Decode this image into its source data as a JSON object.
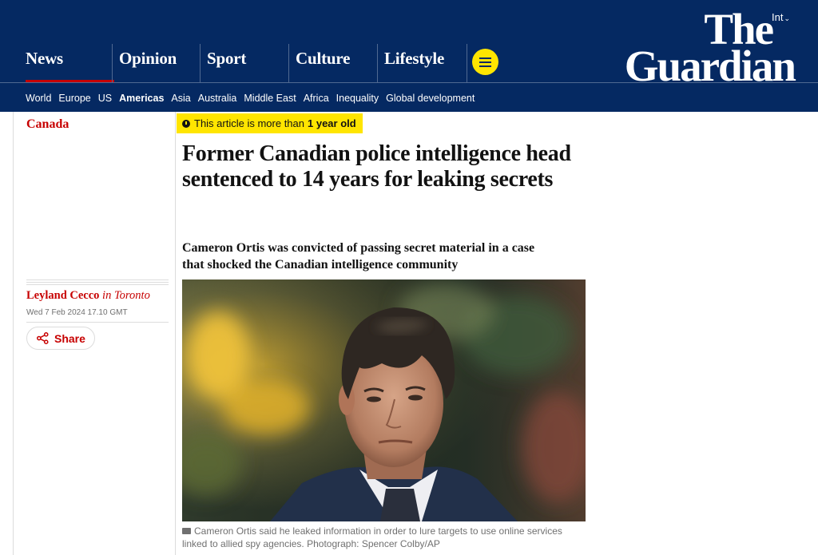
{
  "masthead": {
    "edition": "Int",
    "logo": {
      "line1": "The",
      "line2": "Guardian"
    },
    "pillars": [
      {
        "label": "News",
        "active": true
      },
      {
        "label": "Opinion"
      },
      {
        "label": "Sport"
      },
      {
        "label": "Culture"
      },
      {
        "label": "Lifestyle"
      }
    ],
    "subnav": [
      "World",
      "Europe",
      "US",
      "Americas",
      "Asia",
      "Australia",
      "Middle East",
      "Africa",
      "Inequality",
      "Global development"
    ],
    "subnav_active": "Americas",
    "colors": {
      "brand": "#052962",
      "accent": "#c70000",
      "highlight": "#ffe500"
    }
  },
  "article": {
    "section": "Canada",
    "age_notice": {
      "prefix": "This article is more than",
      "emphasis": "1 year old"
    },
    "headline": "Former Canadian police intelligence head sentenced to 14 years for leaking secrets",
    "standfirst": "Cameron Ortis was convicted of passing secret material in a case that shocked the Canadian intelligence community",
    "byline": {
      "name": "Leyland Cecco",
      "location": "in Toronto"
    },
    "date": "Wed 7 Feb 2024 17.10 GMT",
    "share_label": "Share",
    "image": {
      "icon": "camera-icon",
      "caption": "Cameron Ortis said he leaked information in order to lure targets to use online services linked to allied spy agencies. Photograph: Spencer Colby/AP"
    }
  }
}
